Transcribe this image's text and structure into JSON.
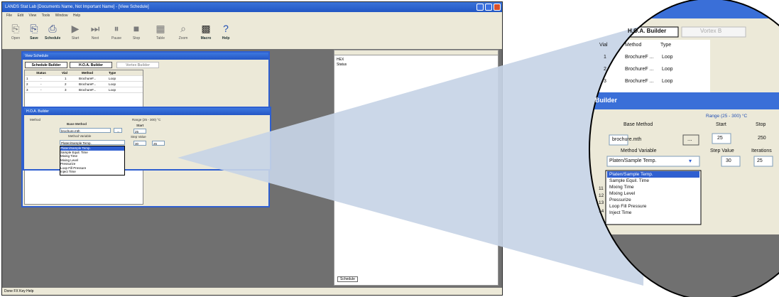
{
  "app": {
    "title": "LANDS Stat Lab [Documents Name, Not Important Name] - [View Schedule]",
    "menu": [
      "File",
      "Edit",
      "View",
      "Tools",
      "Window",
      "Help"
    ],
    "toolbar": [
      {
        "label": "Open",
        "icon": "open-icon"
      },
      {
        "label": "Save",
        "icon": "save-icon"
      },
      {
        "label": "Schedule",
        "icon": "schedule-icon"
      },
      {
        "label": "Start",
        "icon": "play-icon"
      },
      {
        "label": "Next",
        "icon": "skip-icon"
      },
      {
        "label": "Pause",
        "icon": "pause-icon"
      },
      {
        "label": "Stop",
        "icon": "stop-icon"
      },
      {
        "label": "Table",
        "icon": "table-icon"
      },
      {
        "label": "Zoom",
        "icon": "zoom-icon"
      },
      {
        "label": "Macro",
        "icon": "macro-icon"
      },
      {
        "label": "Help",
        "icon": "help-icon"
      }
    ],
    "status": "Done FX Key Help"
  },
  "view_schedule": {
    "title": "View Schedule",
    "tabs": [
      "Schedule Builder",
      "H.O.A. Builder",
      "Vortex Builder"
    ],
    "columns": [
      "Status",
      "Vial",
      "Method",
      "Type"
    ],
    "rows": [
      {
        "n": "1",
        "status": "-",
        "vial": "1",
        "method": "BrochureF...",
        "type": "Loop"
      },
      {
        "n": "2",
        "status": "-",
        "vial": "2",
        "method": "BrochureF...",
        "type": "Loop"
      },
      {
        "n": "3",
        "status": "-",
        "vial": "3",
        "method": "BrochureF...",
        "type": "Loop"
      }
    ]
  },
  "hoa_dialog": {
    "title": "H.O.A. Builder",
    "method_group": "Method",
    "base_method_label": "Base Method",
    "base_method_value": "brochure.mth",
    "browse_button": "...",
    "method_variable_label": "Method Variable",
    "method_variable_value": "Platen/Sample Temp.",
    "range_label": "Range (25 - 300) °C",
    "start_label": "Start",
    "start_value": "25",
    "stop_label": "Stop",
    "stop_value": "250",
    "step_label": "Step Value",
    "step_value": "30",
    "iter_label": "Iterations",
    "iter_value": "25",
    "options": [
      "Platen/Sample Temp.",
      "Sample Equil. Time",
      "Mixing Time",
      "Mixing Level",
      "Pressurize",
      "Loop Fill Pressure",
      "Inject Time"
    ]
  },
  "right_panel": {
    "lines": [
      "HEX",
      "Status"
    ],
    "tab": "Schedule"
  },
  "magnified": {
    "tab_active": "H.O.A. Builder",
    "tab_next": "Vortex B",
    "columns": [
      "Vial",
      "Method",
      "Type"
    ],
    "rows": [
      {
        "vial": "1",
        "method": "BrochureF ...",
        "type": "Loop"
      },
      {
        "vial": "2",
        "method": "BrochureF ...",
        "type": "Loop"
      },
      {
        "vial": "3",
        "method": "BrochureF ...",
        "type": "Loop"
      }
    ],
    "dialog_title": "Builder",
    "row_numbers": [
      "11",
      "12",
      "13",
      "14"
    ]
  },
  "colors": {
    "titlebar": "#2a5dcc",
    "workspace": "#707070",
    "wedge": "#c7d4e6",
    "dropdown_highlight": "#2f5fd0"
  }
}
